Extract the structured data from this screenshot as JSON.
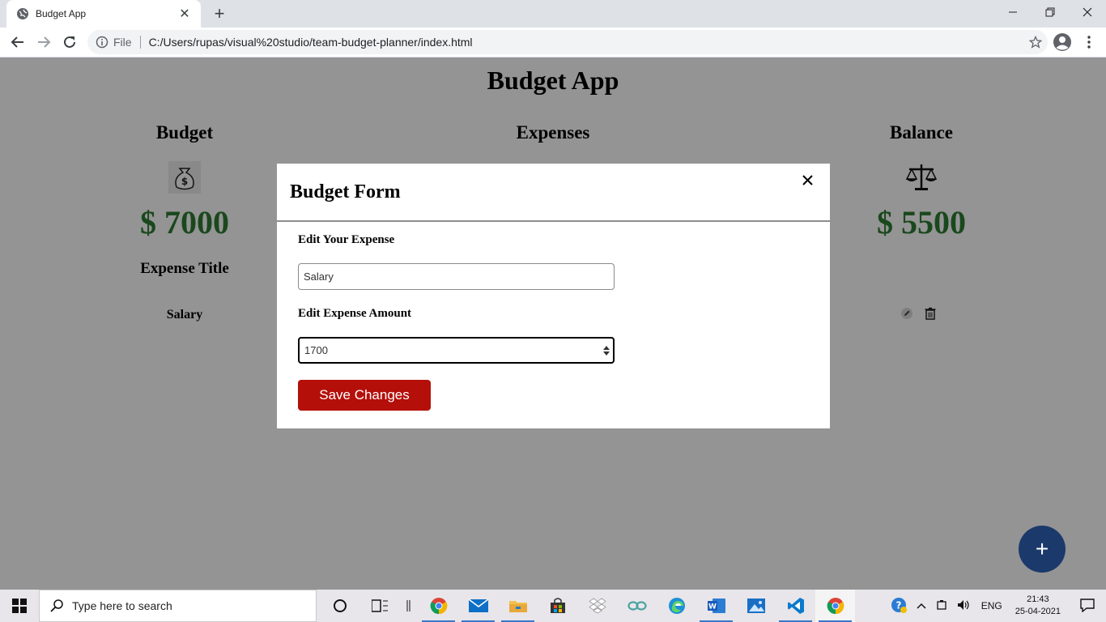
{
  "browser": {
    "tab_title": "Budget App",
    "scheme_label": "File",
    "url": "C:/Users/rupas/visual%20studio/team-budget-planner/index.html"
  },
  "page": {
    "app_title": "Budget App",
    "budget": {
      "heading": "Budget",
      "amount": "$ 7000"
    },
    "expenses": {
      "heading": "Expenses"
    },
    "balance": {
      "heading": "Balance",
      "amount": "$ 5500"
    },
    "expense_list": {
      "header": "Expense Title",
      "items": [
        {
          "title": "Salary"
        }
      ]
    },
    "fab_label": "+"
  },
  "modal": {
    "title": "Budget Form",
    "expense_label": "Edit Your Expense",
    "expense_value": "Salary",
    "amount_label": "Edit Expense Amount",
    "amount_value": "1700",
    "save_label": "Save Changes"
  },
  "taskbar": {
    "search_placeholder": "Type here to search",
    "language": "ENG",
    "time": "21:43",
    "date": "25-04-2021"
  },
  "colors": {
    "amount_green": "#2e7d32",
    "save_red": "#b50f0a",
    "fab_blue": "#1b3a6b"
  }
}
